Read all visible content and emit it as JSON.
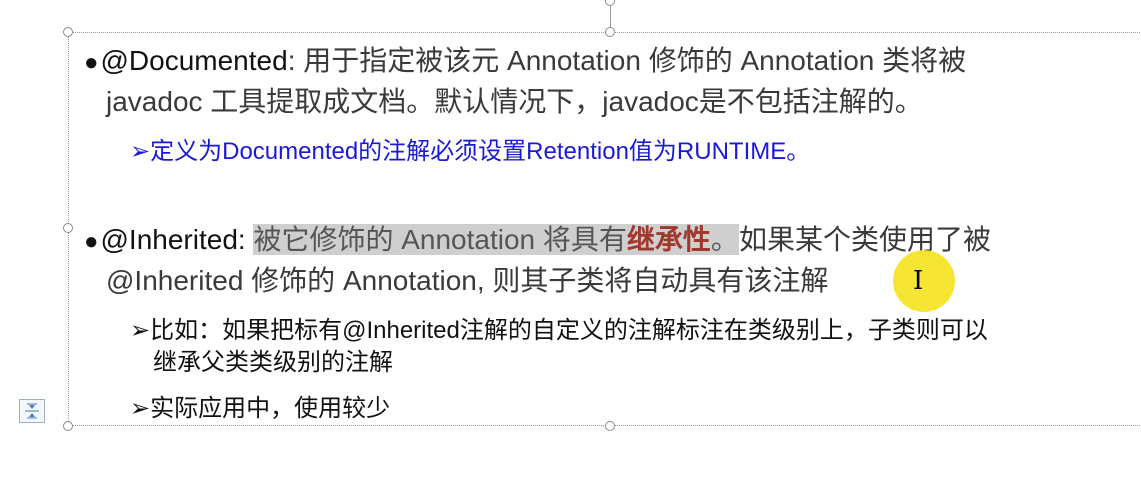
{
  "slide": {
    "item1": {
      "line1": {
        "tag": "@Documented",
        "rest": ": 用于指定被该元 Annotation 修饰的 Annotation 类将被"
      },
      "line2": "javadoc 工具提取成文档。默认情况下，javadoc是不包括注解的。",
      "sub1": "定义为Documented的注解必须设置Retention值为RUNTIME。"
    },
    "item2": {
      "line1": {
        "tag": "@Inherited",
        "colon": ": ",
        "highlight_a": "被它修饰的 Annotation 将具有",
        "highlight_b": "继承性",
        "highlight_c": "。",
        "rest": "如果某个类使用了被"
      },
      "line2": "@Inherited 修饰的 Annotation, 则其子类将自动具有该注解",
      "sub1_line1": "比如：如果把标有@Inherited注解的自定义的注解标注在类级别上，子类则可以",
      "sub1_line2": "继承父类类级别的注解",
      "sub2": "实际应用中，使用较少"
    },
    "symbols": {
      "bullet": "●",
      "arrow": "➢",
      "ibeam": "I"
    },
    "colors": {
      "sub_blue": "#1a1ad4",
      "highlight_bg": "#cfcfcf",
      "highlight_red": "#a0382e",
      "cursor_yellow": "#f5e20f"
    }
  }
}
